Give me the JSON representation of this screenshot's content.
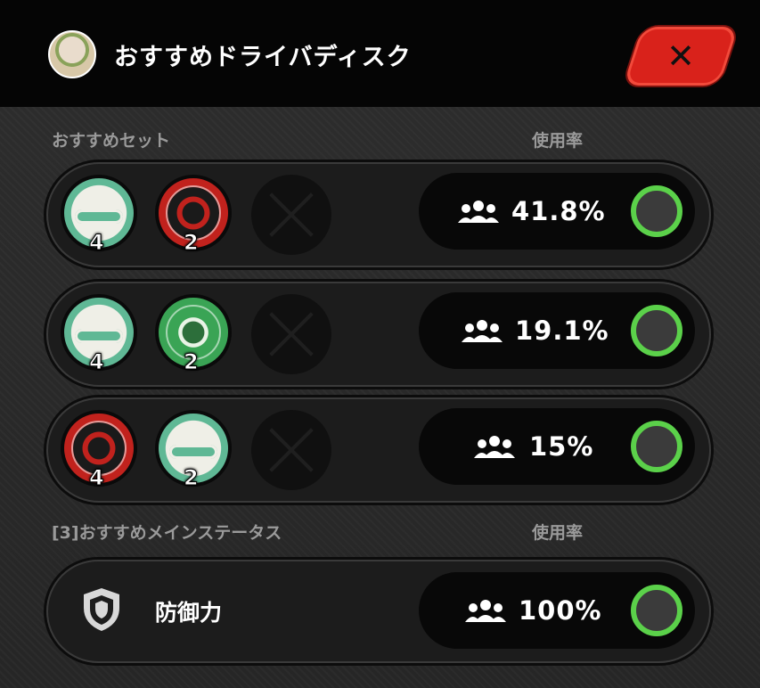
{
  "header": {
    "title": "おすすめドライバディスク",
    "close_label": "✕"
  },
  "sections": {
    "sets_label": "おすすめセット",
    "sets_usage_label": "使用率",
    "main_status_label": "[3]おすすめメインステータス",
    "main_status_usage_label": "使用率"
  },
  "sets": [
    {
      "discs": [
        {
          "type": "freedom",
          "count": "4"
        },
        {
          "type": "red",
          "count": "2"
        }
      ],
      "rate": "41.8%",
      "selected": false
    },
    {
      "discs": [
        {
          "type": "freedom",
          "count": "4"
        },
        {
          "type": "green",
          "count": "2"
        }
      ],
      "rate": "19.1%",
      "selected": false
    },
    {
      "discs": [
        {
          "type": "red",
          "count": "4"
        },
        {
          "type": "freedom",
          "count": "2"
        }
      ],
      "rate": "15%",
      "selected": false
    }
  ],
  "main_status": {
    "stat_name": "防御力",
    "icon": "shield-icon",
    "rate": "100%",
    "selected": false
  },
  "colors": {
    "accent_red": "#d9221b",
    "radio_green": "#5bd14a",
    "disc_teal": "#5fb895"
  }
}
